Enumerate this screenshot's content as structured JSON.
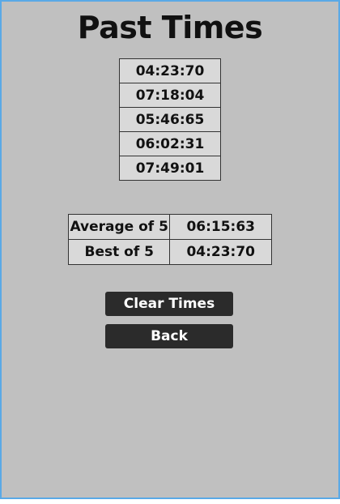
{
  "page": {
    "title": "Past Times"
  },
  "times": [
    "04:23:70",
    "07:18:04",
    "05:46:65",
    "06:02:31",
    "07:49:01"
  ],
  "stats": {
    "average_label": "Average of 5",
    "average_value": "06:15:63",
    "best_label": "Best of 5",
    "best_value": "04:23:70"
  },
  "buttons": {
    "clear_label": "Clear Times",
    "back_label": "Back"
  },
  "colors": {
    "background": "#c0c0c0",
    "cell": "#d9d9d9",
    "button": "#2b2b2b",
    "frame_border": "#5aa9e6"
  }
}
